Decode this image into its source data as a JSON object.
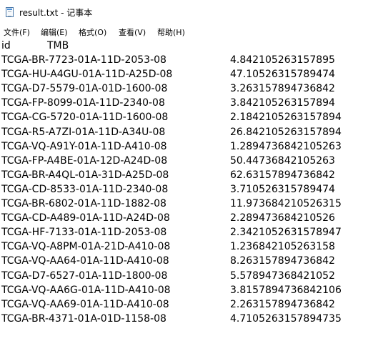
{
  "window": {
    "title": "result.txt - 记事本",
    "icon": "notepad-icon"
  },
  "menu": [
    "文件(F)",
    "编辑(E)",
    "格式(O)",
    "查看(V)",
    "帮助(H)"
  ],
  "header": {
    "id": "id",
    "tmb": "TMB"
  },
  "rows": [
    {
      "id": "TCGA-BR-7723-01A-11D-2053-08",
      "tmb": "4.842105263157895"
    },
    {
      "id": "TCGA-HU-A4GU-01A-11D-A25D-08",
      "tmb": "47.10526315789474"
    },
    {
      "id": "TCGA-D7-5579-01A-01D-1600-08",
      "tmb": "3.263157894736842"
    },
    {
      "id": "TCGA-FP-8099-01A-11D-2340-08",
      "tmb": "3.842105263157894"
    },
    {
      "id": "TCGA-CG-5720-01A-11D-1600-08",
      "tmb": "2.1842105263157894"
    },
    {
      "id": "TCGA-R5-A7ZI-01A-11D-A34U-08",
      "tmb": "26.842105263157894"
    },
    {
      "id": "TCGA-VQ-A91Y-01A-11D-A410-08",
      "tmb": "1.2894736842105263"
    },
    {
      "id": "TCGA-FP-A4BE-01A-12D-A24D-08",
      "tmb": "50.44736842105263"
    },
    {
      "id": "TCGA-BR-A4QL-01A-31D-A25D-08",
      "tmb": "62.63157894736842"
    },
    {
      "id": "TCGA-CD-8533-01A-11D-2340-08",
      "tmb": "3.710526315789474"
    },
    {
      "id": "TCGA-BR-6802-01A-11D-1882-08",
      "tmb": "11.973684210526315"
    },
    {
      "id": "TCGA-CD-A489-01A-11D-A24D-08",
      "tmb": "2.289473684210526"
    },
    {
      "id": "TCGA-HF-7133-01A-11D-2053-08",
      "tmb": "2.3421052631578947"
    },
    {
      "id": "TCGA-VQ-A8PM-01A-21D-A410-08",
      "tmb": "1.236842105263158"
    },
    {
      "id": "TCGA-VQ-AA64-01A-11D-A410-08",
      "tmb": "8.263157894736842"
    },
    {
      "id": "TCGA-D7-6527-01A-11D-1800-08",
      "tmb": "5.578947368421052"
    },
    {
      "id": "TCGA-VQ-AA6G-01A-11D-A410-08",
      "tmb": "3.8157894736842106"
    },
    {
      "id": "TCGA-VQ-AA69-01A-11D-A410-08",
      "tmb": "2.263157894736842"
    },
    {
      "id": "TCGA-BR-4371-01A-01D-1158-08",
      "tmb": "4.7105263157894735"
    }
  ]
}
